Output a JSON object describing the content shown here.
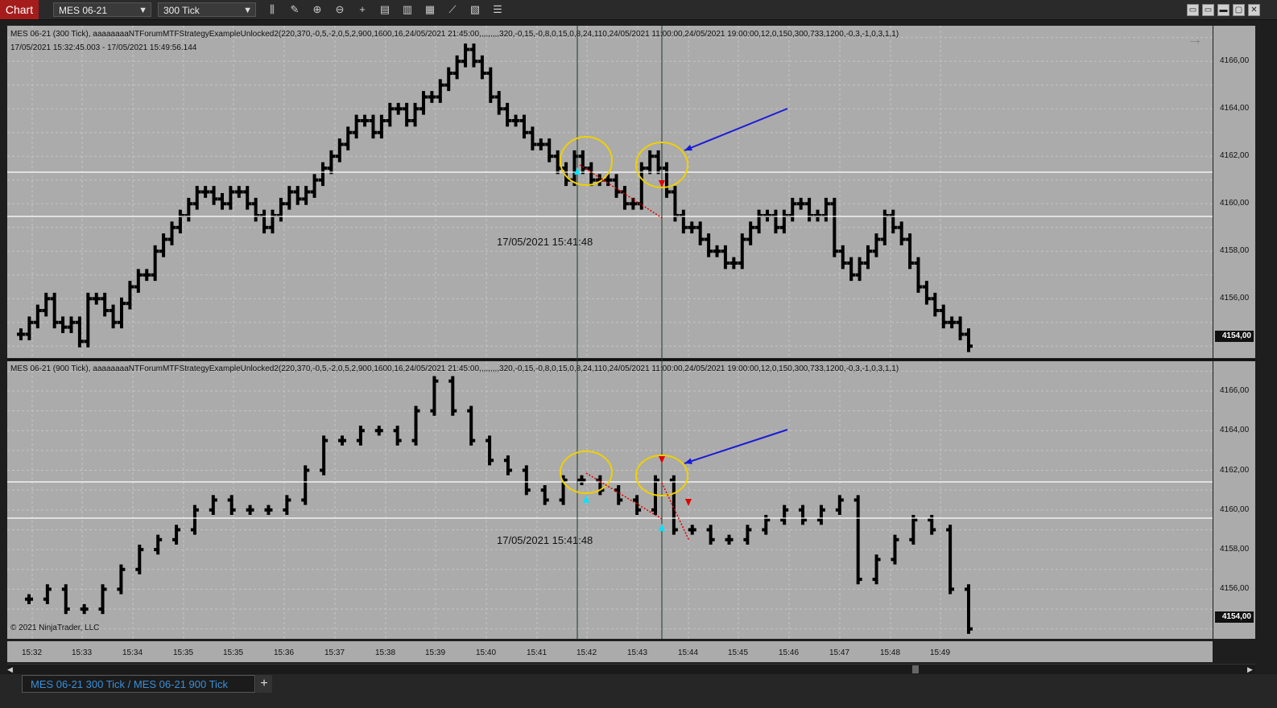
{
  "toolbar": {
    "chart_label": "Chart",
    "instrument": "MES 06-21",
    "interval": "300 Tick",
    "icons": [
      "bar-type-icon",
      "draw-pencil-icon",
      "zoom-in-icon",
      "zoom-out-icon",
      "crosshair-icon",
      "properties-icon",
      "templates-icon",
      "data-box-icon",
      "indicators-icon",
      "strategies-icon",
      "more-icon"
    ],
    "window_buttons": [
      "▭",
      "▭",
      "▬",
      "▢",
      "✕"
    ]
  },
  "top_panel": {
    "title": "MES 06-21 (300 Tick), aaaaaaaaNTForumMTFStrategyExampleUnlocked2(220,370,-0,5,-2,0,5,2,900,1600,16,24/05/2021 21:45:00,,,,,,,,,320,-0,15,-0,8,0,15,0,8,24,110,24/05/2021 11:00:00,24/05/2021 19:00:00,12,0,150,300,733,1200,-0,3,-1,0,3,1,1)",
    "range": "17/05/2021 15:32:45.003 - 17/05/2021 15:49:56.144",
    "date_label": "17/05/2021 15:41:48",
    "price_badge": "4154,00",
    "ticks": [
      "4166,00",
      "4164,00",
      "4162,00",
      "4160,00",
      "4158,00",
      "4156,00"
    ]
  },
  "bottom_panel": {
    "title": "MES 06-21 (900 Tick), aaaaaaaaNTForumMTFStrategyExampleUnlocked2(220,370,-0,5,-2,0,5,2,900,1600,16,24/05/2021 21:45:00,,,,,,,,,320,-0,15,-0,8,0,15,0,8,24,110,24/05/2021 11:00:00,24/05/2021 19:00:00,12,0,150,300,733,1200,-0,3,-1,0,3,1,1)",
    "date_label": "17/05/2021 15:41:48",
    "copyright": "© 2021 NinjaTrader, LLC",
    "price_badge": "4154,00",
    "ticks": [
      "4166,00",
      "4164,00",
      "4162,00",
      "4160,00",
      "4158,00",
      "4156,00"
    ]
  },
  "time_axis": [
    "15:32",
    "15:33",
    "15:34",
    "15:35",
    "15:35",
    "15:36",
    "15:37",
    "15:38",
    "15:39",
    "15:40",
    "15:41",
    "15:42",
    "15:43",
    "15:44",
    "15:45",
    "15:46",
    "15:47",
    "15:48",
    "15:49"
  ],
  "tab_bar": {
    "tab_label": "MES 06-21 300 Tick / MES 06-21 900 Tick",
    "add_label": "+"
  },
  "colors": {
    "panel_bg": "#ababab",
    "bars": "#000000",
    "arrow_blue": "#1a1ad8",
    "ellipse_yellow": "#f0d000",
    "signal_cyan": "#00e5ff",
    "signal_red": "#e00000",
    "chart_tab": "#a51c1c"
  },
  "chart_data": [
    {
      "type": "ohlc",
      "name": "MES 06-21 (300 Tick)",
      "ylim": [
        4153.5,
        4167.5
      ],
      "closes": [
        4154.5,
        4155.0,
        4155.5,
        4156.0,
        4155.0,
        4154.8,
        4155.0,
        4154.2,
        4156.0,
        4156.0,
        4155.5,
        4155.0,
        4155.8,
        4156.5,
        4157.0,
        4157.0,
        4158.0,
        4158.5,
        4159.0,
        4159.5,
        4160.0,
        4160.5,
        4160.5,
        4160.2,
        4160.0,
        4160.5,
        4160.5,
        4160.0,
        4159.5,
        4159.0,
        4159.5,
        4160.0,
        4160.5,
        4160.2,
        4160.5,
        4161.0,
        4161.5,
        4162.0,
        4162.5,
        4163.0,
        4163.5,
        4163.5,
        4163.0,
        4163.5,
        4164.0,
        4164.0,
        4163.5,
        4164.0,
        4164.5,
        4164.5,
        4165.0,
        4165.5,
        4166.0,
        4166.5,
        4166.0,
        4165.5,
        4164.5,
        4164.0,
        4163.5,
        4163.5,
        4163.0,
        4162.5,
        4162.5,
        4162.0,
        4161.5,
        4161.0,
        4162.0,
        4161.5,
        4161.0,
        4161.0,
        4161.0,
        4160.5,
        4160.0,
        4160.0,
        4161.5,
        4162.0,
        4161.5,
        4160.5,
        4159.5,
        4159.0,
        4159.0,
        4158.5,
        4158.0,
        4158.0,
        4157.5,
        4157.5,
        4158.5,
        4159.0,
        4159.5,
        4159.5,
        4159.0,
        4159.5,
        4160.0,
        4160.0,
        4159.5,
        4159.5,
        4160.0,
        4158.0,
        4157.5,
        4157.0,
        4157.5,
        4158.0,
        4158.5,
        4159.5,
        4159.0,
        4158.5,
        4157.5,
        4156.5,
        4156.0,
        4155.5,
        4155.0,
        4155.0,
        4154.5,
        4154.0
      ]
    },
    {
      "type": "ohlc",
      "name": "MES 06-21 (900 Tick)",
      "ylim": [
        4153.5,
        4167.5
      ],
      "closes": [
        4155.5,
        4156.0,
        4155.0,
        4155.0,
        4156.0,
        4157.0,
        4158.0,
        4158.5,
        4159.0,
        4160.0,
        4160.5,
        4160.0,
        4160.0,
        4160.0,
        4160.5,
        4162.0,
        4163.5,
        4163.5,
        4164.0,
        4164.0,
        4163.5,
        4165.0,
        4166.5,
        4165.0,
        4163.5,
        4162.5,
        4162.0,
        4161.0,
        4160.5,
        4161.5,
        4161.5,
        4161.0,
        4160.5,
        4160.0,
        4161.5,
        4159.0,
        4159.0,
        4158.5,
        4158.5,
        4159.0,
        4159.5,
        4160.0,
        4159.5,
        4160.0,
        4160.5,
        4156.5,
        4157.5,
        4158.5,
        4159.5,
        4159.0,
        4156.0,
        4154.0
      ]
    }
  ]
}
